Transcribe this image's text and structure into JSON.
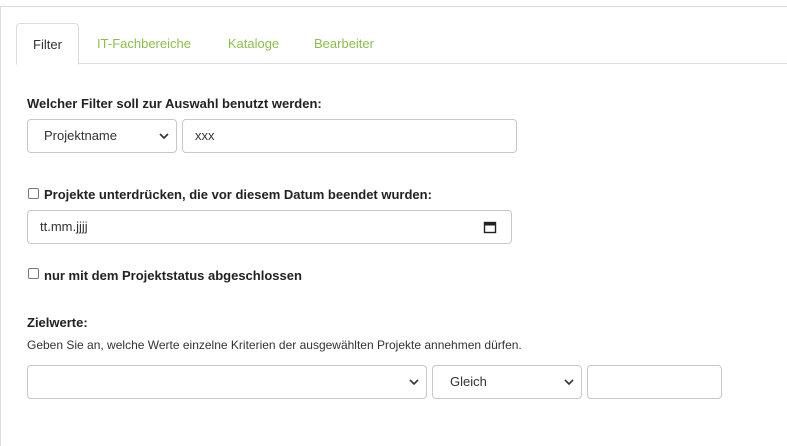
{
  "tabs": [
    {
      "label": "Filter",
      "active": true
    },
    {
      "label": "IT-Fachbereiche",
      "active": false
    },
    {
      "label": "Kataloge",
      "active": false
    },
    {
      "label": "Bearbeiter",
      "active": false
    }
  ],
  "filter": {
    "label": "Welcher Filter soll zur Auswahl benutzt werden:",
    "select_value": "Projektname",
    "text_value": "xxx"
  },
  "suppress": {
    "label": "Projekte unterdrücken, die vor diesem Datum beendet wurden:",
    "checked": false,
    "date_placeholder": "tt.mm.jjjj"
  },
  "status": {
    "label": "nur mit dem Projektstatus abgeschlossen",
    "checked": false
  },
  "targets": {
    "heading": "Zielwerte:",
    "description": "Geben Sie an, welche Werte einzelne Kriterien der ausgewählten Projekte annehmen dürfen.",
    "criterion_value": "",
    "operator_value": "Gleich",
    "value_input": ""
  },
  "colors": {
    "tab_link": "#8bbf4a",
    "border": "#c8c8c8"
  }
}
